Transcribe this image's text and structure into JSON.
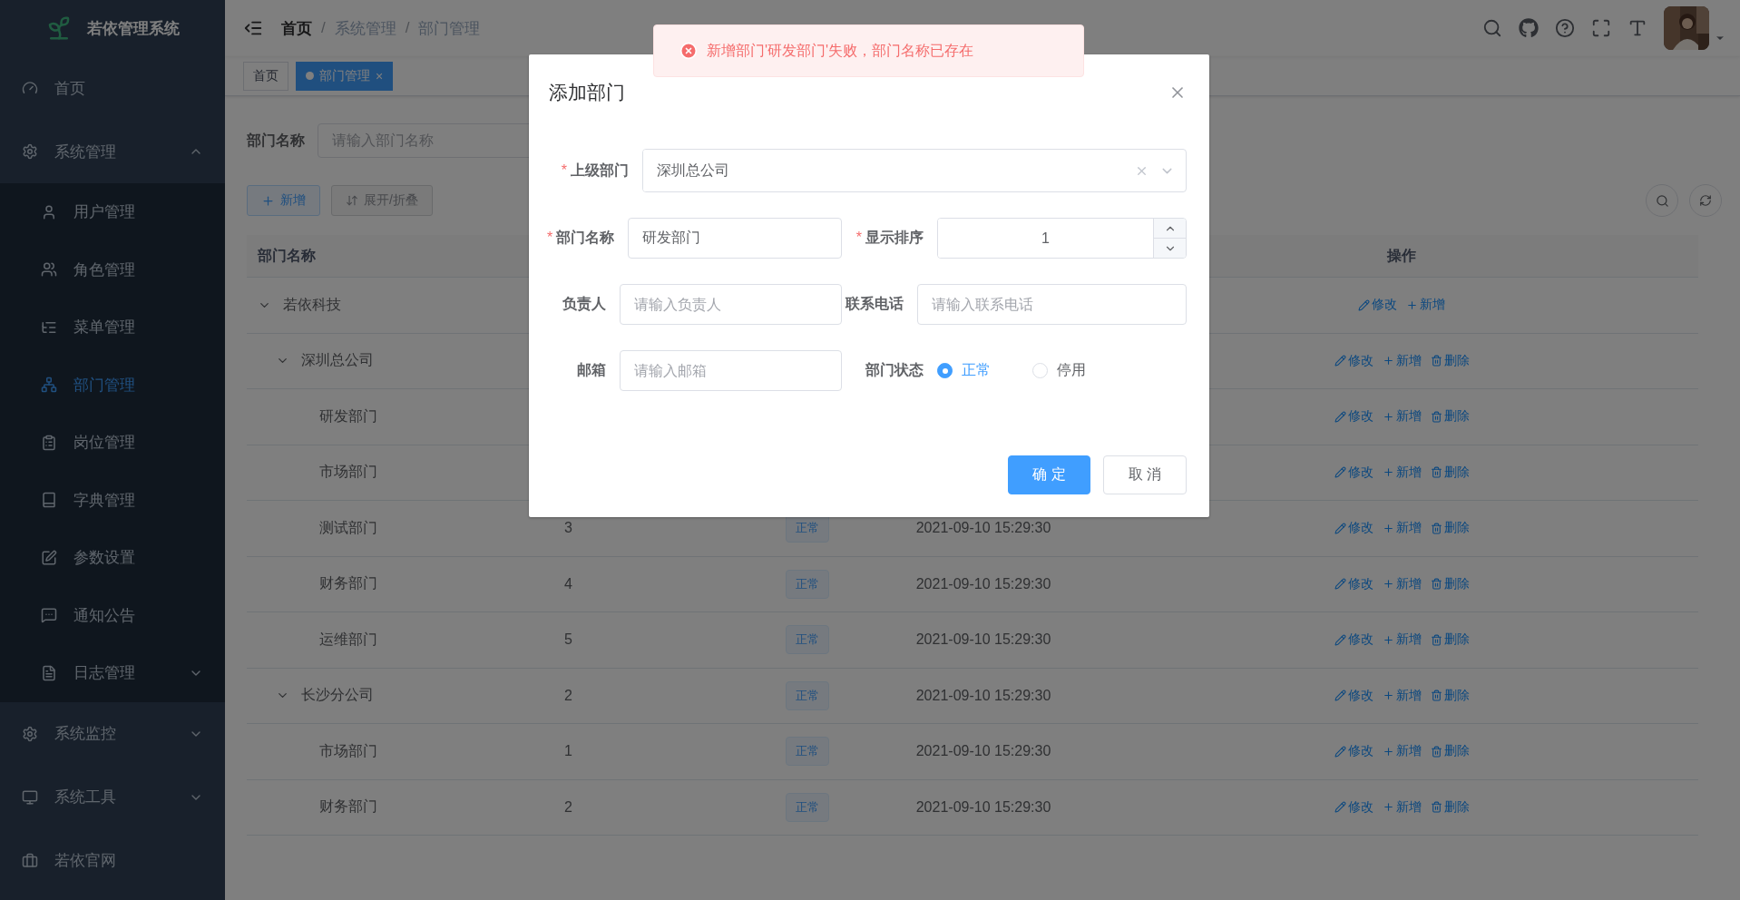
{
  "sidebar": {
    "logo_text": "若依管理系统",
    "items": [
      {
        "kind": "link",
        "label": "首页",
        "selected": false
      },
      {
        "kind": "submenu",
        "label": "系统管理",
        "expanded": true,
        "selected": false,
        "children": [
          {
            "kind": "link",
            "label": "用户管理",
            "selected": false
          },
          {
            "kind": "link",
            "label": "角色管理",
            "selected": false
          },
          {
            "kind": "link",
            "label": "菜单管理",
            "selected": false
          },
          {
            "kind": "link",
            "label": "部门管理",
            "selected": true
          },
          {
            "kind": "link",
            "label": "岗位管理",
            "selected": false
          },
          {
            "kind": "link",
            "label": "字典管理",
            "selected": false
          },
          {
            "kind": "link",
            "label": "参数设置",
            "selected": false
          },
          {
            "kind": "link",
            "label": "通知公告",
            "selected": false
          },
          {
            "kind": "submenu",
            "label": "日志管理",
            "expanded": false,
            "selected": false
          }
        ]
      },
      {
        "kind": "submenu",
        "label": "系统监控",
        "expanded": false,
        "selected": false
      },
      {
        "kind": "submenu",
        "label": "系统工具",
        "expanded": false,
        "selected": false
      },
      {
        "kind": "link",
        "label": "若依官网",
        "selected": false
      }
    ]
  },
  "navbar": {
    "separator": "/",
    "breadcrumb": [
      {
        "label": "首页",
        "link": true
      },
      {
        "label": "系统管理",
        "link": false
      },
      {
        "label": "部门管理",
        "link": false
      }
    ]
  },
  "tags": [
    {
      "label": "首页",
      "selected": false
    },
    {
      "label": "部门管理",
      "selected": true,
      "close": "×"
    }
  ],
  "search": {
    "label": "部门名称",
    "placeholder": "请输入部门名称"
  },
  "toolbar": [
    {
      "kind": "add",
      "label": "新增"
    },
    {
      "kind": "toggle",
      "label": "展开/折叠"
    }
  ],
  "table": {
    "columns": [
      "部门名称",
      "操作"
    ],
    "rows": [
      {
        "name": "若依科技",
        "expanded": true,
        "actions": [
          {
            "kind": "edit",
            "label": "修改"
          },
          {
            "kind": "add",
            "label": "新增"
          }
        ],
        "children": [
          {
            "name": "深圳总公司",
            "expanded": true,
            "actions": [
              {
                "kind": "edit",
                "label": "修改"
              },
              {
                "kind": "add",
                "label": "新增"
              },
              {
                "kind": "delete",
                "label": "删除"
              }
            ],
            "children": [
              {
                "name": "研发部门",
                "actions": [
                  {
                    "kind": "edit",
                    "label": "修改"
                  },
                  {
                    "kind": "add",
                    "label": "新增"
                  },
                  {
                    "kind": "delete",
                    "label": "删除"
                  }
                ]
              },
              {
                "name": "市场部门",
                "actions": [
                  {
                    "kind": "edit",
                    "label": "修改"
                  },
                  {
                    "kind": "add",
                    "label": "新增"
                  },
                  {
                    "kind": "delete",
                    "label": "删除"
                  }
                ]
              },
              {
                "name": "测试部门",
                "sort": "3",
                "status": "正常",
                "created": "2021-09-10 15:29:30",
                "actions": [
                  {
                    "kind": "edit",
                    "label": "修改"
                  },
                  {
                    "kind": "add",
                    "label": "新增"
                  },
                  {
                    "kind": "delete",
                    "label": "删除"
                  }
                ]
              },
              {
                "name": "财务部门",
                "sort": "4",
                "status": "正常",
                "created": "2021-09-10 15:29:30",
                "actions": [
                  {
                    "kind": "edit",
                    "label": "修改"
                  },
                  {
                    "kind": "add",
                    "label": "新增"
                  },
                  {
                    "kind": "delete",
                    "label": "删除"
                  }
                ]
              },
              {
                "name": "运维部门",
                "sort": "5",
                "status": "正常",
                "created": "2021-09-10 15:29:30",
                "actions": [
                  {
                    "kind": "edit",
                    "label": "修改"
                  },
                  {
                    "kind": "add",
                    "label": "新增"
                  },
                  {
                    "kind": "delete",
                    "label": "删除"
                  }
                ]
              }
            ]
          },
          {
            "name": "长沙分公司",
            "sort": "2",
            "status": "正常",
            "created": "2021-09-10 15:29:30",
            "expanded": true,
            "actions": [
              {
                "kind": "edit",
                "label": "修改"
              },
              {
                "kind": "add",
                "label": "新增"
              },
              {
                "kind": "delete",
                "label": "删除"
              }
            ],
            "children": [
              {
                "name": "市场部门",
                "sort": "1",
                "status": "正常",
                "created": "2021-09-10 15:29:30",
                "actions": [
                  {
                    "kind": "edit",
                    "label": "修改"
                  },
                  {
                    "kind": "add",
                    "label": "新增"
                  },
                  {
                    "kind": "delete",
                    "label": "删除"
                  }
                ]
              },
              {
                "name": "财务部门",
                "sort": "2",
                "status": "正常",
                "created": "2021-09-10 15:29:30",
                "actions": [
                  {
                    "kind": "edit",
                    "label": "修改"
                  },
                  {
                    "kind": "add",
                    "label": "新增"
                  },
                  {
                    "kind": "delete",
                    "label": "删除"
                  }
                ]
              }
            ]
          }
        ]
      }
    ]
  },
  "dialog": {
    "title": "添加部门",
    "required_mark": "*",
    "fields": [
      {
        "kind": "tree-select",
        "label": "上级部门",
        "required": true,
        "value": "深圳总公司"
      },
      {
        "kind": "input",
        "label": "部门名称",
        "required": true,
        "value": "研发部门"
      },
      {
        "kind": "number",
        "label": "显示排序",
        "required": true,
        "value": "1"
      },
      {
        "kind": "input",
        "label": "负责人",
        "required": false,
        "placeholder": "请输入负责人"
      },
      {
        "kind": "input",
        "label": "联系电话",
        "required": false,
        "placeholder": "请输入联系电话"
      },
      {
        "kind": "input",
        "label": "邮箱",
        "required": false,
        "placeholder": "请输入邮箱"
      },
      {
        "kind": "radio",
        "label": "部门状态",
        "required": false,
        "options": [
          {
            "label": "正常",
            "selected": true
          },
          {
            "label": "停用",
            "selected": false
          }
        ]
      }
    ],
    "buttons": [
      {
        "kind": "primary",
        "label": "确 定"
      },
      {
        "kind": "default",
        "label": "取 消"
      }
    ]
  },
  "message": {
    "text": "新增部门'研发部门'失败，部门名称已存在"
  }
}
